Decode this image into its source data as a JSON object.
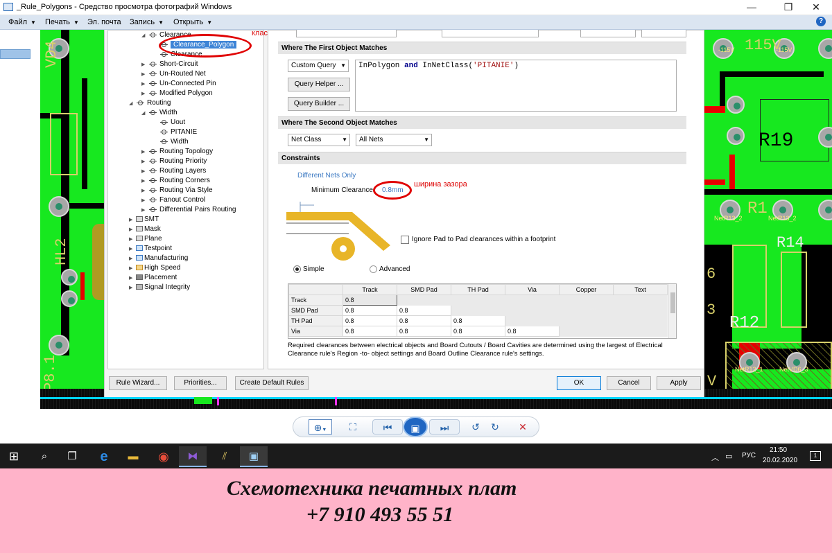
{
  "window": {
    "title": "_Rule_Polygons - Средство просмотра фотографий Windows",
    "controls": [
      "—",
      "❐",
      "✕"
    ]
  },
  "menu": {
    "items": [
      "Файл",
      "Печать",
      "Эл. почта",
      "Запись",
      "Открыть"
    ],
    "help": "?"
  },
  "tree": {
    "items": [
      {
        "label": "Clearance",
        "level": 1
      },
      {
        "label": "Clearance_Polygon",
        "level": 2,
        "selected": true
      },
      {
        "label": "Clearance",
        "level": 2
      },
      {
        "label": "Short-Circuit",
        "level": 1
      },
      {
        "label": "Un-Routed Net",
        "level": 1
      },
      {
        "label": "Un-Connected Pin",
        "level": 1
      },
      {
        "label": "Modified Polygon",
        "level": 1
      },
      {
        "label": "Routing",
        "level": 0
      },
      {
        "label": "Width",
        "level": 1
      },
      {
        "label": "Uout",
        "level": 2
      },
      {
        "label": "PITANIE",
        "level": 2
      },
      {
        "label": "Width",
        "level": 2
      },
      {
        "label": "Routing Topology",
        "level": 1
      },
      {
        "label": "Routing Priority",
        "level": 1
      },
      {
        "label": "Routing Layers",
        "level": 1
      },
      {
        "label": "Routing Corners",
        "level": 1
      },
      {
        "label": "Routing Via Style",
        "level": 1
      },
      {
        "label": "Fanout Control",
        "level": 1
      },
      {
        "label": "Differential Pairs Routing",
        "level": 1
      },
      {
        "label": "SMT",
        "level": 0
      },
      {
        "label": "Mask",
        "level": 0
      },
      {
        "label": "Plane",
        "level": 0
      },
      {
        "label": "Testpoint",
        "level": 0
      },
      {
        "label": "Manufacturing",
        "level": 0
      },
      {
        "label": "High Speed",
        "level": 0
      },
      {
        "label": "Placement",
        "level": 0
      },
      {
        "label": "Signal Integrity",
        "level": 0
      }
    ]
  },
  "annotations": {
    "class_label": "класс",
    "gap_label": "ширина зазора"
  },
  "first_match": {
    "header": "Where The First Object Matches",
    "mode": "Custom Query",
    "query_helper": "Query Helper ...",
    "query_builder": "Query Builder ...",
    "query": {
      "a": "InPolygon ",
      "kw": "and",
      "b": " InNetClass(",
      "str": "'PITANIE'",
      "c": ")"
    }
  },
  "second_match": {
    "header": "Where The Second Object Matches",
    "type": "Net Class",
    "value": "All Nets"
  },
  "constraints": {
    "header": "Constraints",
    "different_nets": "Different Nets Only",
    "min_clearance_label": "Minimum Clearance",
    "min_clearance_value": "0.8mm",
    "ignore_pad": "Ignore Pad to Pad clearances within a footprint",
    "simple": "Simple",
    "advanced": "Advanced",
    "columns": [
      "",
      "Track",
      "SMD Pad",
      "TH Pad",
      "Via",
      "Copper",
      "Text"
    ],
    "rows": [
      {
        "name": "Track",
        "values": [
          "0.8"
        ]
      },
      {
        "name": "SMD Pad",
        "values": [
          "0.8",
          "0.8"
        ]
      },
      {
        "name": "TH Pad",
        "values": [
          "0.8",
          "0.8",
          "0.8"
        ]
      },
      {
        "name": "Via",
        "values": [
          "0.8",
          "0.8",
          "0.8",
          "0.8"
        ]
      }
    ],
    "note": "Required clearances between electrical objects and Board Cutouts / Board Cavities are determined using the largest of Electrical Clearance rule's Region -to- object settings and Board Outline Clearance rule's settings."
  },
  "buttons": {
    "rule_wizard": "Rule Wizard...",
    "priorities": "Priorities...",
    "create_default": "Create Default Rules",
    "ok": "OK",
    "cancel": "Cancel",
    "apply": "Apply"
  },
  "pcb": {
    "left": [
      "VD4",
      "HL2",
      "XP8.1"
    ],
    "right": [
      "-115V",
      "115V",
      "-115V",
      "R19",
      "R1",
      "NetR13_2",
      "NetR13_2",
      "R14",
      "6",
      "3",
      "R12",
      "NetR12_1",
      "NetVD6_3",
      "V"
    ]
  },
  "taskbar": {
    "lang": "РУС",
    "time": "21:50",
    "date": "20.02.2020",
    "notif": "1"
  },
  "footer": {
    "line1": "Схемотехника печатных  плат",
    "line2": "+7 910 493 55 51"
  },
  "colors": {
    "pcb_green": "#17e81f",
    "pcb_red": "#e60000",
    "accent": "#3d84d6",
    "footer_bg": "#ffb3c9"
  }
}
